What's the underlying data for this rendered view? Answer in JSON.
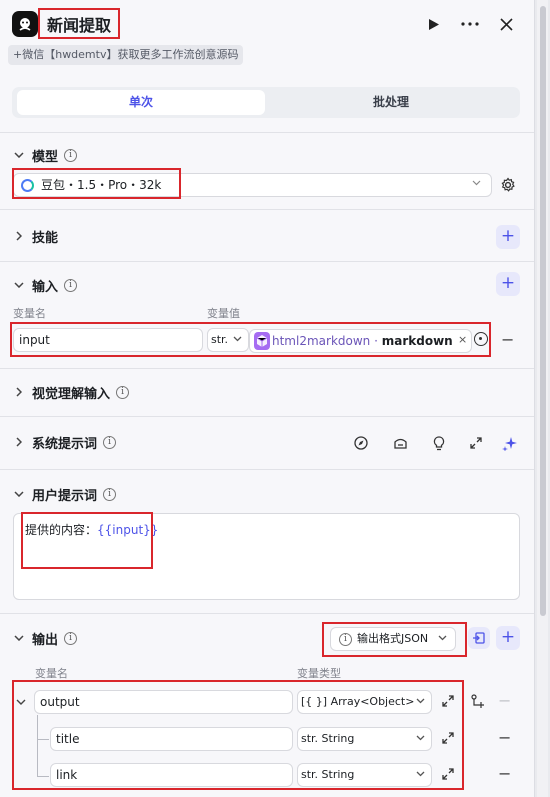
{
  "header": {
    "title": "新闻提取",
    "subtitle": "+微信【hwdemtv】获取更多工作流创意源码",
    "run_icon": "play-icon",
    "more_icon": "more-icon",
    "close_icon": "close-icon"
  },
  "tabs": [
    {
      "label": "单次",
      "active": true
    },
    {
      "label": "批处理",
      "active": false
    }
  ],
  "model": {
    "section_label": "模型",
    "selected": "豆包・1.5・Pro・32k"
  },
  "skills": {
    "section_label": "技能"
  },
  "input": {
    "section_label": "输入",
    "col_name": "变量名",
    "col_value": "变量值",
    "rows": [
      {
        "name": "input",
        "type": "str.",
        "ref_node": "html2markdown",
        "ref_sep": " · ",
        "ref_field": "markdown"
      }
    ]
  },
  "vision": {
    "section_label": "视觉理解输入"
  },
  "system_prompt": {
    "section_label": "系统提示词"
  },
  "user_prompt": {
    "section_label": "用户提示词",
    "text_prefix": "提供的内容：",
    "text_var": "{{input}}"
  },
  "output": {
    "section_label": "输出",
    "format_label": "输出格式JSON",
    "col_name": "变量名",
    "col_type": "变量类型",
    "rows": [
      {
        "name": "output",
        "type": "[{ }] Array<Object>"
      },
      {
        "name": "title",
        "type": "str. String"
      },
      {
        "name": "link",
        "type": "str. String"
      }
    ]
  },
  "colors": {
    "accent": "#4d53e8",
    "highlight_box": "#d9262c"
  }
}
